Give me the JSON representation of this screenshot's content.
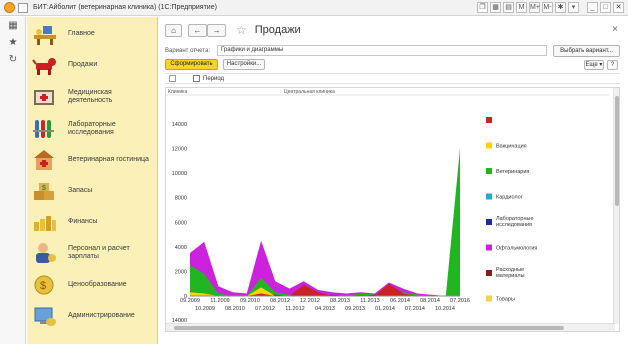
{
  "window": {
    "title": "БИТ:Айболит (ветеринарная клиника) (1С:Предприятие)",
    "tools": [
      "❐",
      "▦",
      "▤",
      "M",
      "M+",
      "M-",
      "✱",
      "▾",
      "_",
      "□",
      "✕"
    ]
  },
  "leftbar": {
    "items": [
      {
        "icon": "grid-icon",
        "glyph": "▦"
      },
      {
        "icon": "star-icon",
        "glyph": "★"
      },
      {
        "icon": "history-icon",
        "glyph": "↻"
      }
    ]
  },
  "sections": [
    {
      "label": "Главное",
      "icon": "desk-icon"
    },
    {
      "label": "Продажи",
      "icon": "dog-icon"
    },
    {
      "label": "Медицинская деятельность",
      "icon": "medical-book-icon"
    },
    {
      "label": "Лабораторные исследования",
      "icon": "test-tubes-icon"
    },
    {
      "label": "Ветеринарная гостиница",
      "icon": "hotel-icon"
    },
    {
      "label": "Запасы",
      "icon": "boxes-icon"
    },
    {
      "label": "Финансы",
      "icon": "coins-icon"
    },
    {
      "label": "Персонал и расчет зарплаты",
      "icon": "person-icon"
    },
    {
      "label": "Ценообразование",
      "icon": "price-icon"
    },
    {
      "label": "Администрирование",
      "icon": "admin-icon"
    }
  ],
  "page": {
    "home_glyph": "⌂",
    "back_glyph": "←",
    "forward_glyph": "→",
    "star_glyph": "☆",
    "title": "Продажи",
    "close_glyph": "×"
  },
  "report": {
    "variant_label": "Вариант отчета:",
    "variant_value": "Графики и диаграммы",
    "choose_variant_button": "Выбрать вариант...",
    "generate_button": "Сформировать",
    "settings_button": "Настройки...",
    "more_button": "Еще ▾",
    "help_button": "?",
    "period_label": "Период"
  },
  "chart_data": {
    "type": "area",
    "headers": [
      "Клиника",
      "Центральная клиника"
    ],
    "y_ticks": [
      0,
      2000,
      4000,
      6000,
      8000,
      10000,
      12000,
      14000
    ],
    "y_ticks_below": [
      14000
    ],
    "ylim": [
      0,
      14000
    ],
    "x_labels_top": [
      "09.2009",
      "11.2009",
      "09.2010",
      "08.2012",
      "12.2012",
      "08.2013",
      "11.2013",
      "06.2014",
      "08.2014",
      "07.2016"
    ],
    "x_labels_bottom": [
      "10.2009",
      "08.2010",
      "07.2012",
      "11.2012",
      "04.2013",
      "09.2013",
      "01.2014",
      "07.2014",
      "10.2014"
    ],
    "x": [
      0,
      1,
      2,
      3,
      4,
      5,
      6,
      7,
      8,
      9,
      10,
      11,
      12,
      13,
      14,
      15,
      16,
      17,
      18,
      19
    ],
    "series": [
      {
        "name": "",
        "color": "#cc2222",
        "values": [
          0,
          0,
          0,
          0,
          0,
          200,
          0,
          0,
          900,
          300,
          0,
          0,
          100,
          0,
          1000,
          200,
          0,
          0,
          0,
          0
        ]
      },
      {
        "name": "Вакцинация",
        "color": "#ffd200",
        "values": [
          300,
          200,
          0,
          0,
          0,
          700,
          0,
          0,
          0,
          0,
          0,
          0,
          0,
          0,
          100,
          0,
          0,
          0,
          0,
          0
        ]
      },
      {
        "name": "Ветеринария",
        "color": "#22b522",
        "values": [
          2500,
          1800,
          200,
          0,
          0,
          1500,
          300,
          100,
          200,
          100,
          0,
          0,
          200,
          100,
          400,
          300,
          100,
          0,
          0,
          12000
        ]
      },
      {
        "name": "Кардиолог",
        "color": "#2aa6d6",
        "values": [
          0,
          0,
          0,
          0,
          0,
          100,
          0,
          0,
          0,
          0,
          0,
          0,
          0,
          0,
          0,
          0,
          0,
          0,
          0,
          0
        ]
      },
      {
        "name": "Лабораторные исследования",
        "color": "#1a2a9a",
        "values": [
          0,
          0,
          0,
          0,
          0,
          300,
          100,
          0,
          0,
          0,
          100,
          0,
          0,
          100,
          0,
          0,
          0,
          0,
          0,
          0
        ]
      },
      {
        "name": "Офтальмология",
        "color": "#cc22dd",
        "values": [
          3500,
          4400,
          800,
          300,
          200,
          4500,
          1200,
          600,
          1200,
          500,
          300,
          200,
          300,
          200,
          1100,
          600,
          200,
          100,
          0,
          0
        ]
      },
      {
        "name": "Расходные материалы",
        "color": "#8b1a1a",
        "values": [
          0,
          0,
          0,
          0,
          0,
          0,
          0,
          0,
          0,
          0,
          0,
          0,
          0,
          0,
          0,
          0,
          0,
          0,
          0,
          0
        ]
      },
      {
        "name": "Товары",
        "color": "#f2d24a",
        "values": [
          0,
          0,
          0,
          0,
          0,
          0,
          0,
          0,
          0,
          0,
          0,
          0,
          0,
          0,
          0,
          0,
          0,
          0,
          0,
          0
        ]
      }
    ],
    "legend_position": "right",
    "grid": false
  }
}
